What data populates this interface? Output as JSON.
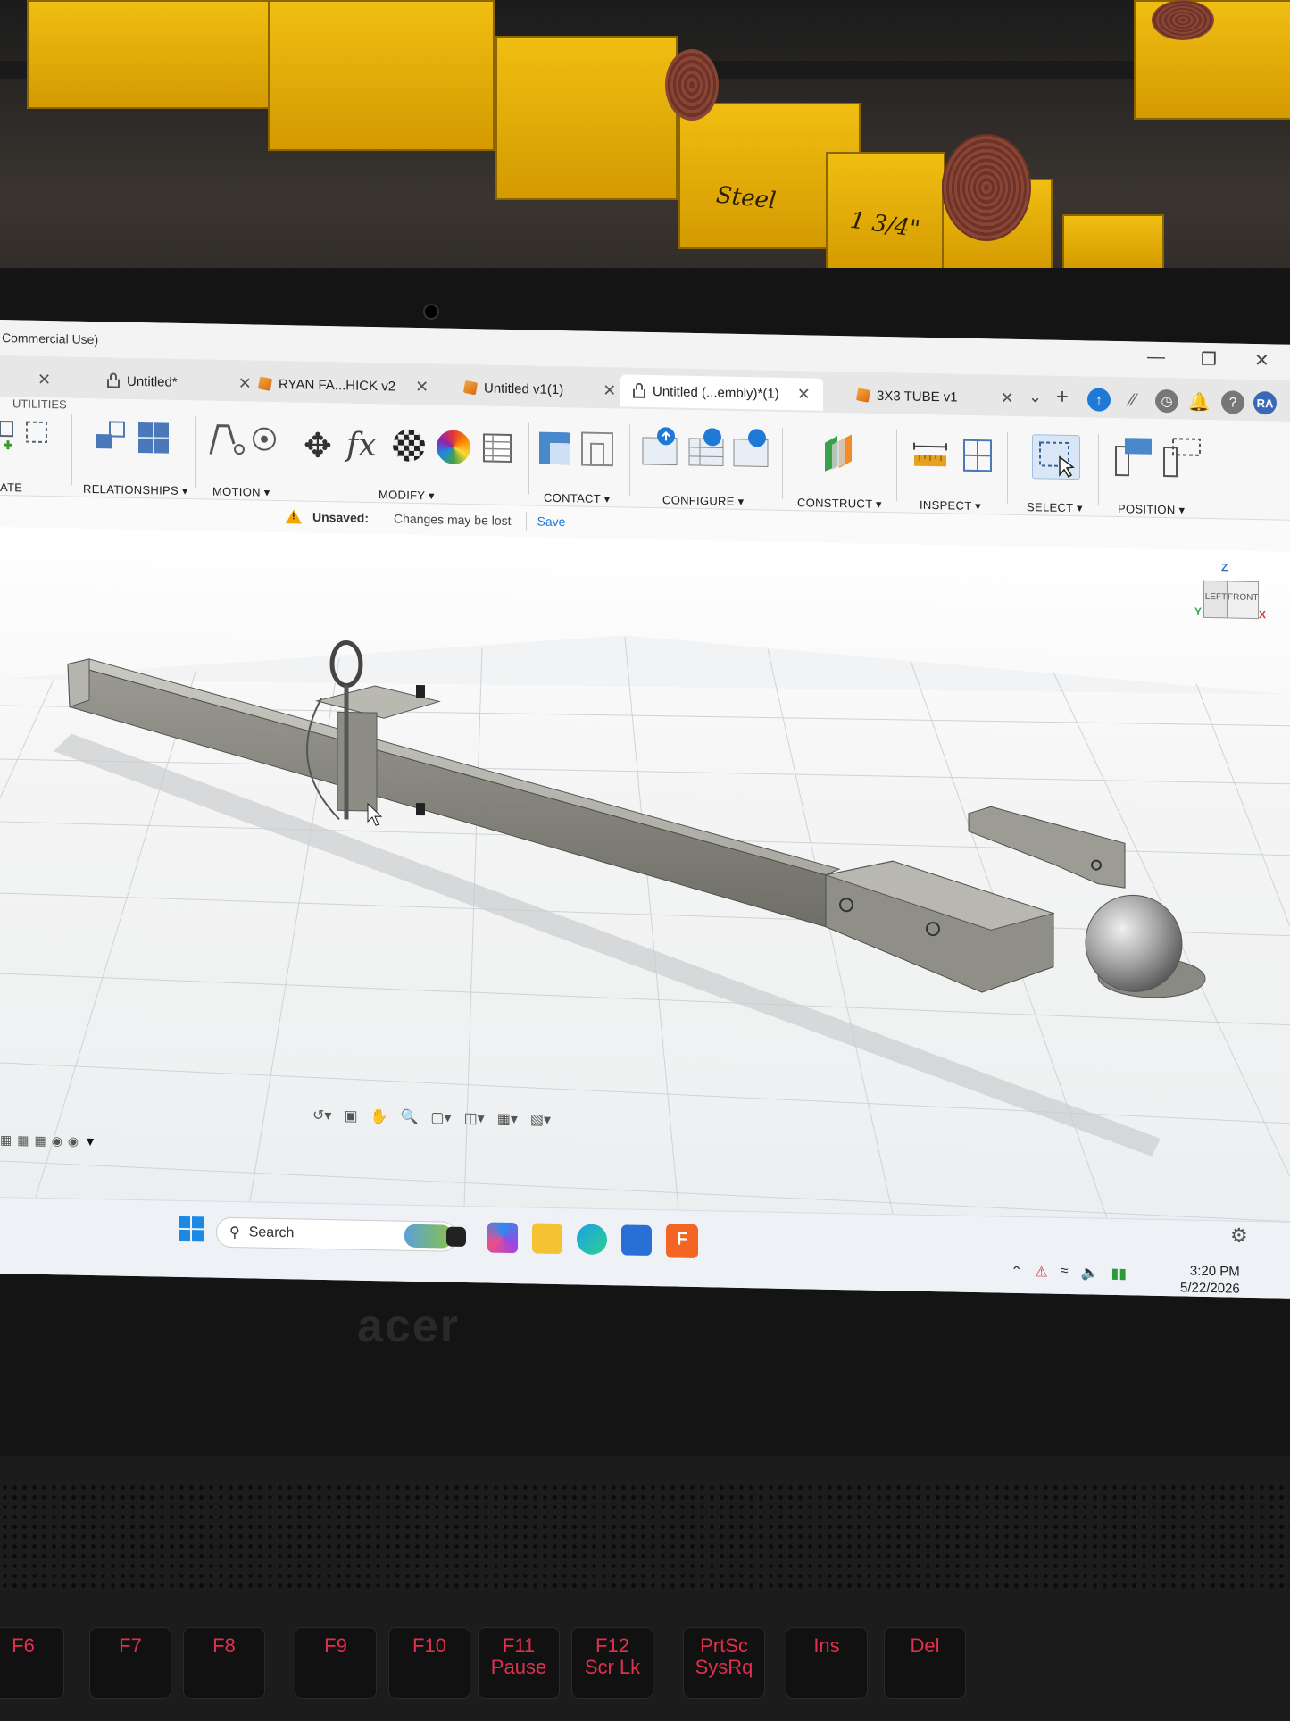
{
  "window": {
    "title": "Commercial Use)"
  },
  "tabs": [
    {
      "label": "Untitled*",
      "locked": true
    },
    {
      "label": "RYAN FA...HICK v2"
    },
    {
      "label": "Untitled v1(1)"
    },
    {
      "label": "Untitled (...embly)*(1)",
      "locked": true,
      "active": true
    },
    {
      "label": "3X3 TUBE v1"
    }
  ],
  "header_icons": {
    "avatar": "RA"
  },
  "ribbon": {
    "utilities_tab": "UTILITIES",
    "groups": {
      "create_partial": "ATE",
      "relationships": "RELATIONSHIPS",
      "motion": "MOTION",
      "modify": "MODIFY",
      "contact": "CONTACT",
      "configure": "CONFIGURE",
      "construct": "CONSTRUCT",
      "inspect": "INSPECT",
      "select": "SELECT",
      "position": "POSITION"
    }
  },
  "warning": {
    "title": "Unsaved:",
    "message": "Changes may be lost",
    "action": "Save"
  },
  "viewcube": {
    "left": "LEFT",
    "front": "FRONT",
    "axis_z": "Z",
    "axis_x": "X",
    "axis_y": "Y"
  },
  "taskbar": {
    "search_placeholder": "Search",
    "time": "3:20 PM",
    "date": "5/22/2026"
  },
  "background": {
    "bin_labels": [
      "Steel",
      "1 3/4\""
    ],
    "laptop_brand": "acer"
  },
  "keyboard": {
    "fkeys": [
      "F6",
      "F7",
      "F8",
      "F9",
      "F10",
      "F11",
      "F12",
      "PrtSc",
      "Ins",
      "Del"
    ],
    "sublabels": [
      "",
      "",
      "",
      "",
      "",
      "Pause",
      "Scr Lk",
      "SysRq",
      "",
      ""
    ]
  },
  "colors": {
    "accent": "#0696d7",
    "warning": "#f2a600",
    "bin_yellow": "#f0be12",
    "fkey_red": "#e0304f"
  }
}
